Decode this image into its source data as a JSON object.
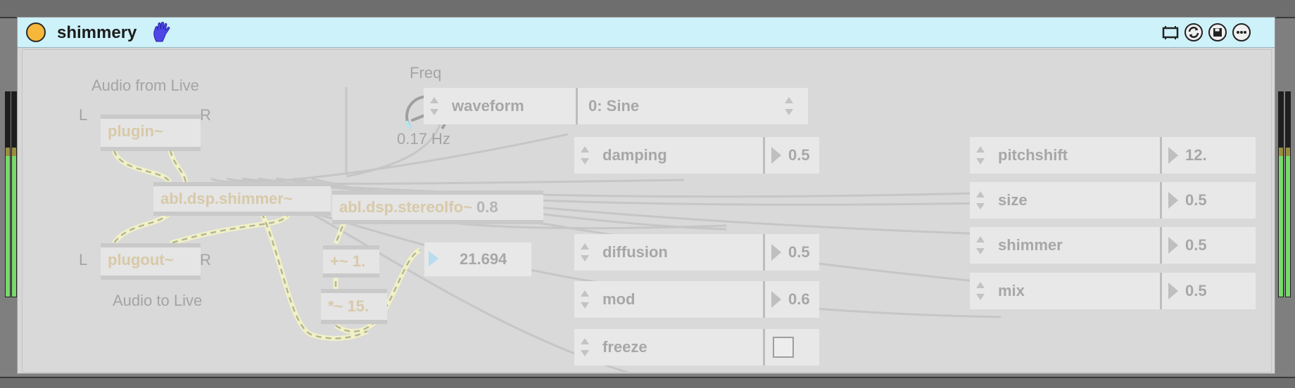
{
  "device": {
    "title": "shimmery",
    "accent": "#f7b73b",
    "titlebar_bg": "#cdf2fa",
    "icons": [
      "hand-icon",
      "device-view-icon",
      "refresh-icon",
      "save-icon",
      "more-icon"
    ]
  },
  "patch": {
    "audio_from_live": "Audio from Live",
    "audio_to_live": "Audio to Live",
    "left_in": "L",
    "right_in": "R",
    "left_out": "L",
    "right_out": "R",
    "plugin": "plugin~",
    "plugout": "plugout~",
    "shimmer": "abl.dsp.shimmer~",
    "stereolfo": "abl.dsp.stereolfo~",
    "stereolfo_arg": "0.8",
    "plus_op": "+~ 1.",
    "times_op": "*~ 15.",
    "number_display": "21.694",
    "freq_label": "Freq",
    "freq_value": "0.17 Hz",
    "freq_level": 0.17
  },
  "controls": {
    "waveform": {
      "name": "waveform",
      "value": "0: Sine"
    },
    "damping": {
      "name": "damping",
      "value": "0.5"
    },
    "diffusion": {
      "name": "diffusion",
      "value": "0.5"
    },
    "mod": {
      "name": "mod",
      "value": "0.6"
    },
    "freeze": {
      "name": "freeze",
      "checked": false
    },
    "pitchshift": {
      "name": "pitchshift",
      "value": "12."
    },
    "size": {
      "name": "size",
      "value": "0.5"
    },
    "shimmer": {
      "name": "shimmer",
      "value": "0.5"
    },
    "mix": {
      "name": "mix",
      "value": "0.5"
    }
  }
}
